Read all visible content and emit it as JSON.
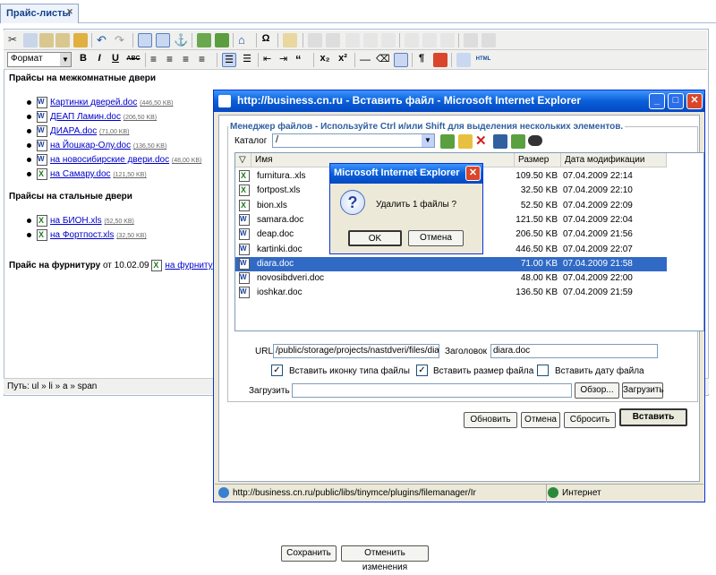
{
  "tab": {
    "label": "Прайс-листы"
  },
  "toolbar": {
    "format_value": "Формат",
    "bold": "B",
    "italic": "I",
    "underline": "U",
    "abc": "ABC",
    "sub": "x₂",
    "sup": "x²",
    "omega": "Ω",
    "pilcrow": "¶",
    "html": "HTML"
  },
  "content": {
    "section1": "Прайсы на межкомнатные двери",
    "list1": [
      {
        "name": "Картинки дверей.doc",
        "size": "(446,50 KB)",
        "icon": "doc"
      },
      {
        "name": "ДЕАП Ламин.doc",
        "size": "(206,50 KB)",
        "icon": "doc"
      },
      {
        "name": "ДИАРА.doc",
        "size": "(71,00 KB)",
        "icon": "doc"
      },
      {
        "name": "на Йошкар-Олу.doc",
        "size": "(136,50 KB)",
        "icon": "doc"
      },
      {
        "name": "на новосибирские двери.doc",
        "size": "(48,00 KB)",
        "icon": "doc"
      },
      {
        "name": "на Самару.doc",
        "size": "(121,50 KB)",
        "icon": "xls"
      }
    ],
    "section2": "Прайсы на стальные двери",
    "list2": [
      {
        "name": "на БИОН.xls",
        "size": "(52,50 KB)",
        "icon": "xls"
      },
      {
        "name": "на Фортпост.xls",
        "size": "(32,50 KB)",
        "icon": "xls"
      }
    ],
    "section3": "Прайс на фурнитуру",
    "section3_date": "от 10.02.09",
    "section3_link": "на фурниту"
  },
  "path": "Путь: ul » li » a » span",
  "footer": {
    "save": "Сохранить",
    "cancel": "Отменить изменения"
  },
  "ie": {
    "title": "http://business.cn.ru - Вставить файл - Microsoft Internet Explorer",
    "legend": "Менеджер файлов - Используйте Ctrl и/или Shift для выделения нескольких элементов.",
    "catalog_label": "Каталог",
    "catalog_value": "/",
    "columns": {
      "name": "Имя",
      "size": "Размер",
      "date": "Дата модификации"
    },
    "files": [
      {
        "name": "furnitura..xls",
        "size": "109.50 KB",
        "date": "07.04.2009 22:14",
        "icon": "xls"
      },
      {
        "name": "fortpost.xls",
        "size": "32.50 KB",
        "date": "07.04.2009 22:10",
        "icon": "xls"
      },
      {
        "name": "bion.xls",
        "size": "52.50 KB",
        "date": "07.04.2009 22:09",
        "icon": "xls"
      },
      {
        "name": "samara.doc",
        "size": "121.50 KB",
        "date": "07.04.2009 22:04",
        "icon": "doc"
      },
      {
        "name": "deap.doc",
        "size": "206.50 KB",
        "date": "07.04.2009 21:56",
        "icon": "doc"
      },
      {
        "name": "kartinki.doc",
        "size": "446.50 KB",
        "date": "07.04.2009 22:07",
        "icon": "doc"
      },
      {
        "name": "diara.doc",
        "size": "71.00 KB",
        "date": "07.04.2009 21:58",
        "icon": "doc"
      },
      {
        "name": "novosibdveri.doc",
        "size": "48.00 KB",
        "date": "07.04.2009 22:00",
        "icon": "doc"
      },
      {
        "name": "ioshkar.doc",
        "size": "136.50 KB",
        "date": "07.04.2009 21:59",
        "icon": "doc"
      }
    ],
    "selected_index": 6,
    "url_label": "URL",
    "url_value": "/public/storage/projects/nastdveri/files/diara.d",
    "header_label": "Заголовок",
    "header_value": "diara.doc",
    "opt_icon": "Вставить иконку типа файлы",
    "opt_size": "Вставить размер файла",
    "opt_date": "Вставить дату файла",
    "upload_label": "Загрузить",
    "browse": "Обзор...",
    "upload_btn": "Загрузить",
    "refresh": "Обновить",
    "cancel": "Отмена",
    "reset": "Сбросить",
    "insert": "Вставить",
    "status_url": "http://business.cn.ru/public/libs/tinymce/plugins/filemanager/Ir",
    "status_zone": "Интернет"
  },
  "msgbox": {
    "title": "Microsoft Internet Explorer",
    "text": "Удалить 1 файлы ?",
    "ok": "OK",
    "cancel": "Отмена"
  }
}
